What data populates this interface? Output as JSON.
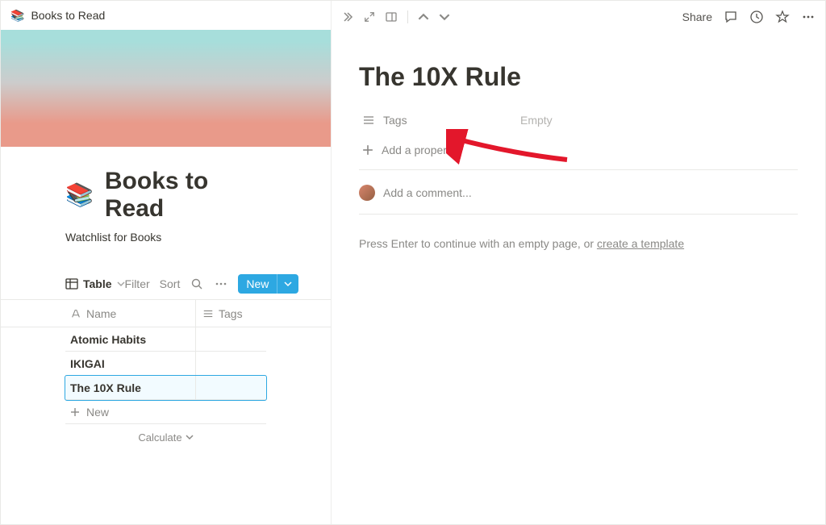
{
  "left": {
    "breadcrumb": {
      "icon": "📚",
      "title": "Books to Read"
    },
    "page": {
      "icon": "📚",
      "title": "Books to Read",
      "subtitle": "Watchlist for Books"
    },
    "viewbar": {
      "view_name": "Table",
      "filter": "Filter",
      "sort": "Sort",
      "new": "New"
    },
    "columns": {
      "name": "Name",
      "tags": "Tags"
    },
    "rows": [
      {
        "name": "Atomic Habits"
      },
      {
        "name": "IKIGAI"
      },
      {
        "name": "The 10X Rule",
        "selected": true
      }
    ],
    "new_row": "New",
    "calculate": "Calculate"
  },
  "right": {
    "topbar": {
      "share": "Share"
    },
    "title": "The 10X Rule",
    "properties": {
      "tags": {
        "label": "Tags",
        "value": "Empty"
      },
      "add": "Add a property"
    },
    "comment_placeholder": "Add a comment...",
    "hint_prefix": "Press Enter to continue with an empty page, or ",
    "hint_link": "create a template"
  }
}
